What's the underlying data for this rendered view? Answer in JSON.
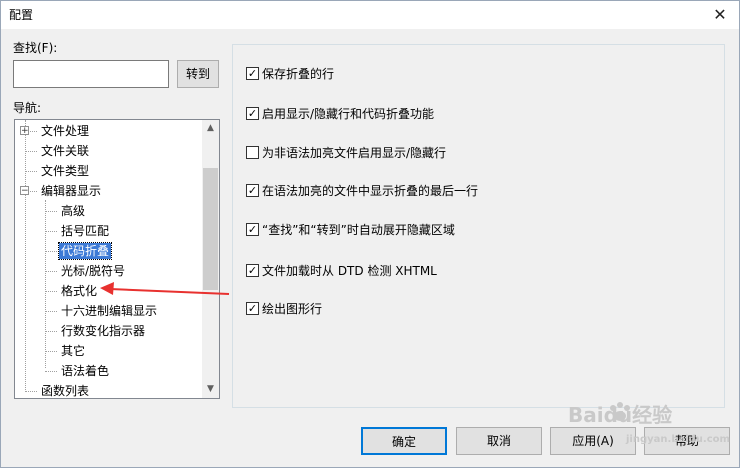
{
  "window": {
    "title": "配置",
    "close_glyph": "✕"
  },
  "search": {
    "label": "查找(F):",
    "value": "",
    "goto_label": "转到"
  },
  "nav": {
    "label": "导航:",
    "items": [
      {
        "label": "文件处理",
        "level": 0,
        "expander": "+",
        "selected": false
      },
      {
        "label": "文件关联",
        "level": 0,
        "expander": "",
        "selected": false
      },
      {
        "label": "文件类型",
        "level": 0,
        "expander": "",
        "selected": false
      },
      {
        "label": "编辑器显示",
        "level": 0,
        "expander": "−",
        "selected": false
      },
      {
        "label": "高级",
        "level": 1,
        "expander": "",
        "selected": false
      },
      {
        "label": "括号匹配",
        "level": 1,
        "expander": "",
        "selected": false
      },
      {
        "label": "代码折叠",
        "level": 1,
        "expander": "",
        "selected": true
      },
      {
        "label": "光标/脱符号",
        "level": 1,
        "expander": "",
        "selected": false
      },
      {
        "label": "格式化",
        "level": 1,
        "expander": "",
        "selected": false
      },
      {
        "label": "十六进制编辑显示",
        "level": 1,
        "expander": "",
        "selected": false
      },
      {
        "label": "行数变化指示器",
        "level": 1,
        "expander": "",
        "selected": false
      },
      {
        "label": "其它",
        "level": 1,
        "expander": "",
        "selected": false
      },
      {
        "label": "语法着色",
        "level": 1,
        "expander": "",
        "selected": false
      },
      {
        "label": "函数列表",
        "level": 0,
        "expander": "",
        "selected": false
      }
    ]
  },
  "options": [
    {
      "label": "保存折叠的行",
      "checked": true
    },
    {
      "label": "启用显示/隐藏行和代码折叠功能",
      "checked": true
    },
    {
      "label": "为非语法加亮文件启用显示/隐藏行",
      "checked": false
    },
    {
      "label": "在语法加亮的文件中显示折叠的最后一行",
      "checked": true
    },
    {
      "label": "“查找”和“转到”时自动展开隐藏区域",
      "checked": true
    },
    {
      "label": "文件加载时从 DTD 检测 XHTML",
      "checked": true
    },
    {
      "label": "绘出图形行",
      "checked": true
    }
  ],
  "buttons": {
    "ok": "确定",
    "cancel": "取消",
    "apply": "应用(A)",
    "help": "帮助"
  },
  "watermark": {
    "text": "Baidu经验",
    "url": "jingyan.baidu.com"
  },
  "colors": {
    "selection": "#3d7ad6",
    "annotation_arrow": "#e8312f",
    "default_button_border": "#0078d7"
  },
  "icons": {
    "check": "✓",
    "scroll_up": "▲",
    "scroll_down": "▼"
  }
}
